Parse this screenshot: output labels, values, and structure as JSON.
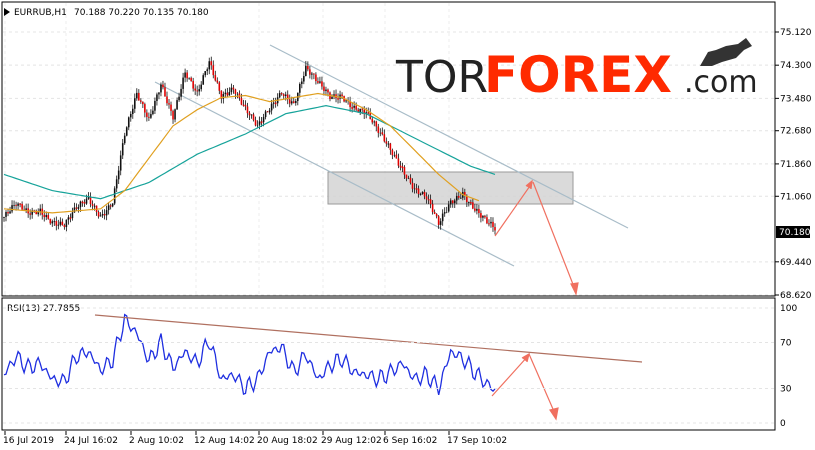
{
  "header": {
    "symbol": "EURRUB,H1",
    "ohlc": "70.188 70.220 70.135 70.180"
  },
  "watermark": {
    "text_black": "TOR",
    "text_red": "FOREX",
    "text_suffix": ".com"
  },
  "chart_data": {
    "type": "line",
    "price_axis": {
      "ticks": [
        "75.120",
        "74.300",
        "73.480",
        "72.680",
        "71.860",
        "71.060",
        "69.440",
        "68.620"
      ],
      "ylim": [
        68.62,
        75.12
      ],
      "last_price_label": "70.180",
      "last_price": 70.18
    },
    "time_axis": {
      "labels": [
        "16 Jul 2019",
        "24 Jul 16:02",
        "2 Aug 10:02",
        "12 Aug 14:02",
        "20 Aug 18:02",
        "29 Aug 12:02",
        "6 Sep 16:02",
        "17 Sep 10:02"
      ]
    },
    "price_series": {
      "name": "EURRUB close",
      "x": [
        0,
        3,
        6,
        9,
        12,
        15,
        18,
        21,
        24,
        27,
        30,
        33,
        36,
        39,
        42,
        45,
        48,
        51,
        54,
        57,
        60,
        63,
        66,
        69,
        72,
        75,
        78,
        81,
        84,
        87,
        90,
        93,
        96,
        99,
        102,
        105,
        108,
        111,
        114,
        117,
        120,
        122
      ],
      "values": [
        70.55,
        70.8,
        70.6,
        70.75,
        70.5,
        70.35,
        70.7,
        70.95,
        70.6,
        71.0,
        72.6,
        73.5,
        72.9,
        73.9,
        73.1,
        74.1,
        73.5,
        74.35,
        73.6,
        73.8,
        73.2,
        72.7,
        73.2,
        73.7,
        73.4,
        74.2,
        73.8,
        73.5,
        73.6,
        73.3,
        73.1,
        72.6,
        72.2,
        71.8,
        71.3,
        71.0,
        70.3,
        70.9,
        71.2,
        70.8,
        70.4,
        70.18
      ]
    },
    "ma_orange": {
      "x": [
        0,
        12,
        24,
        30,
        36,
        42,
        48,
        54,
        60,
        66,
        72,
        78,
        84,
        90,
        96,
        102,
        108,
        114,
        118
      ],
      "values": [
        70.75,
        70.65,
        70.75,
        71.2,
        72.0,
        72.8,
        73.2,
        73.5,
        73.55,
        73.4,
        73.5,
        73.6,
        73.5,
        73.2,
        72.8,
        72.2,
        71.6,
        71.1,
        70.95
      ]
    },
    "ma_teal": {
      "x": [
        0,
        12,
        24,
        36,
        48,
        60,
        70,
        80,
        90,
        100,
        108,
        116,
        122
      ],
      "values": [
        71.6,
        71.2,
        71.0,
        71.4,
        72.1,
        72.6,
        73.1,
        73.3,
        73.1,
        72.6,
        72.2,
        71.8,
        71.6
      ]
    },
    "rsi": {
      "label": "RSI(13) 27.7855",
      "ticks": [
        "100",
        "70",
        "30",
        "0"
      ],
      "ylim": [
        0,
        100
      ],
      "x": [
        0,
        3,
        6,
        9,
        12,
        15,
        18,
        21,
        24,
        27,
        30,
        33,
        36,
        39,
        42,
        45,
        48,
        51,
        54,
        57,
        60,
        63,
        66,
        69,
        72,
        75,
        78,
        81,
        84,
        87,
        90,
        93,
        96,
        99,
        102,
        105,
        108,
        111,
        114,
        117,
        120,
        122
      ],
      "values": [
        42,
        58,
        48,
        52,
        38,
        36,
        58,
        62,
        46,
        55,
        90,
        78,
        54,
        70,
        48,
        62,
        52,
        72,
        38,
        42,
        30,
        38,
        62,
        66,
        44,
        60,
        38,
        50,
        56,
        44,
        42,
        38,
        44,
        52,
        38,
        42,
        30,
        62,
        56,
        44,
        34,
        28
      ]
    }
  }
}
